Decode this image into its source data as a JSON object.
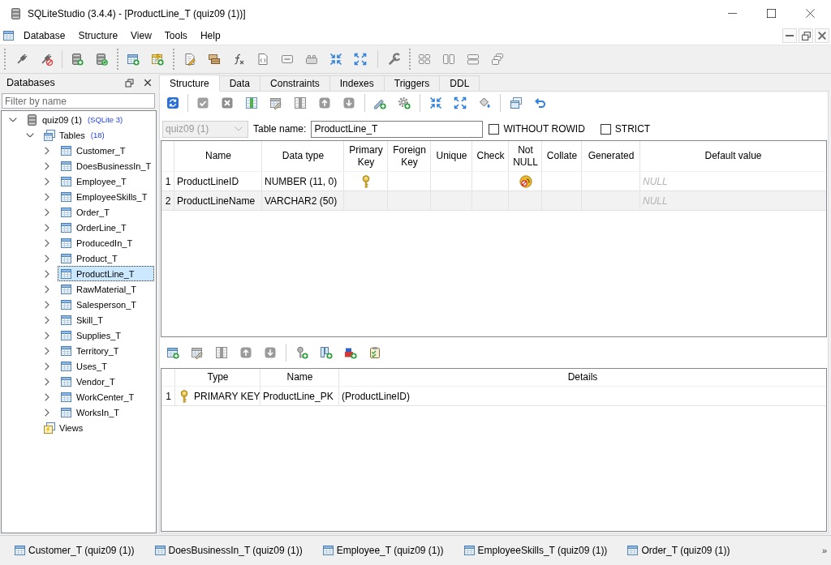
{
  "window": {
    "title": "SQLiteStudio (3.4.4) - [ProductLine_T (quiz09 (1))]"
  },
  "menu": [
    "Database",
    "Structure",
    "View",
    "Tools",
    "Help"
  ],
  "databases_panel": {
    "title": "Databases",
    "filter": {
      "placeholder": "Filter by name"
    },
    "tree": [
      {
        "kind": "database",
        "label": "quiz09 (1)",
        "badge": "(SQLite 3)",
        "expanded": true,
        "selected": false,
        "children": [
          {
            "kind": "tables",
            "label": "Tables",
            "badge": "(18)",
            "expanded": true,
            "selected": false,
            "children": [
              {
                "kind": "table",
                "label": "Customer_T",
                "expanded": false,
                "selected": false
              },
              {
                "kind": "table",
                "label": "DoesBusinessIn_T",
                "expanded": false,
                "selected": false
              },
              {
                "kind": "table",
                "label": "Employee_T",
                "expanded": false,
                "selected": false
              },
              {
                "kind": "table",
                "label": "EmployeeSkills_T",
                "expanded": false,
                "selected": false
              },
              {
                "kind": "table",
                "label": "Order_T",
                "expanded": false,
                "selected": false
              },
              {
                "kind": "table",
                "label": "OrderLine_T",
                "expanded": false,
                "selected": false
              },
              {
                "kind": "table",
                "label": "ProducedIn_T",
                "expanded": false,
                "selected": false
              },
              {
                "kind": "table",
                "label": "Product_T",
                "expanded": false,
                "selected": false
              },
              {
                "kind": "table",
                "label": "ProductLine_T",
                "expanded": false,
                "selected": true
              },
              {
                "kind": "table",
                "label": "RawMaterial_T",
                "expanded": false,
                "selected": false
              },
              {
                "kind": "table",
                "label": "Salesperson_T",
                "expanded": false,
                "selected": false
              },
              {
                "kind": "table",
                "label": "Skill_T",
                "expanded": false,
                "selected": false
              },
              {
                "kind": "table",
                "label": "Supplies_T",
                "expanded": false,
                "selected": false
              },
              {
                "kind": "table",
                "label": "Territory_T",
                "expanded": false,
                "selected": false
              },
              {
                "kind": "table",
                "label": "Uses_T",
                "expanded": false,
                "selected": false
              },
              {
                "kind": "table",
                "label": "Vendor_T",
                "expanded": false,
                "selected": false
              },
              {
                "kind": "table",
                "label": "WorkCenter_T",
                "expanded": false,
                "selected": false
              },
              {
                "kind": "table",
                "label": "WorksIn_T",
                "expanded": false,
                "selected": false
              }
            ]
          },
          {
            "kind": "views",
            "label": "Views",
            "selected": false
          }
        ]
      }
    ]
  },
  "tabs": [
    {
      "label": "Structure",
      "selected": true
    },
    {
      "label": "Data",
      "selected": false
    },
    {
      "label": "Constraints",
      "selected": false
    },
    {
      "label": "Indexes",
      "selected": false
    },
    {
      "label": "Triggers",
      "selected": false
    },
    {
      "label": "DDL",
      "selected": false
    }
  ],
  "table_form": {
    "database": {
      "value": "quiz09 (1)",
      "disabled": true
    },
    "table_name": {
      "label": "Table name:",
      "value": "ProductLine_T"
    },
    "options": [
      {
        "label": "WITHOUT ROWID",
        "checked": false
      },
      {
        "label": "STRICT",
        "checked": false
      }
    ]
  },
  "columns_grid": {
    "columns": [
      "Name",
      "Data type",
      "Primary Key",
      "Foreign Key",
      "Unique",
      "Check",
      "Not NULL",
      "Collate",
      "Generated",
      "Default value"
    ],
    "rows": [
      {
        "number": "1",
        "name": "ProductLineID",
        "data_type": "NUMBER (11, 0)",
        "primary_key": true,
        "not_null": true,
        "default_value": "NULL"
      },
      {
        "number": "2",
        "name": "ProductLineName",
        "data_type": "VARCHAR2 (50)",
        "primary_key": false,
        "not_null": false,
        "default_value": "NULL"
      }
    ]
  },
  "constraints_grid": {
    "columns": [
      "Type",
      "Name",
      "Details"
    ],
    "rows": [
      {
        "number": "1",
        "kind": "primary_key",
        "type": "PRIMARY KEY",
        "name": "ProductLine_PK",
        "details": "(ProductLineID)"
      }
    ]
  },
  "window_bar": {
    "items": [
      "Customer_T (quiz09 (1))",
      "DoesBusinessIn_T (quiz09 (1))",
      "Employee_T (quiz09 (1))",
      "EmployeeSkills_T (quiz09 (1))",
      "Order_T (quiz09 (1))"
    ],
    "overflow": "»"
  }
}
